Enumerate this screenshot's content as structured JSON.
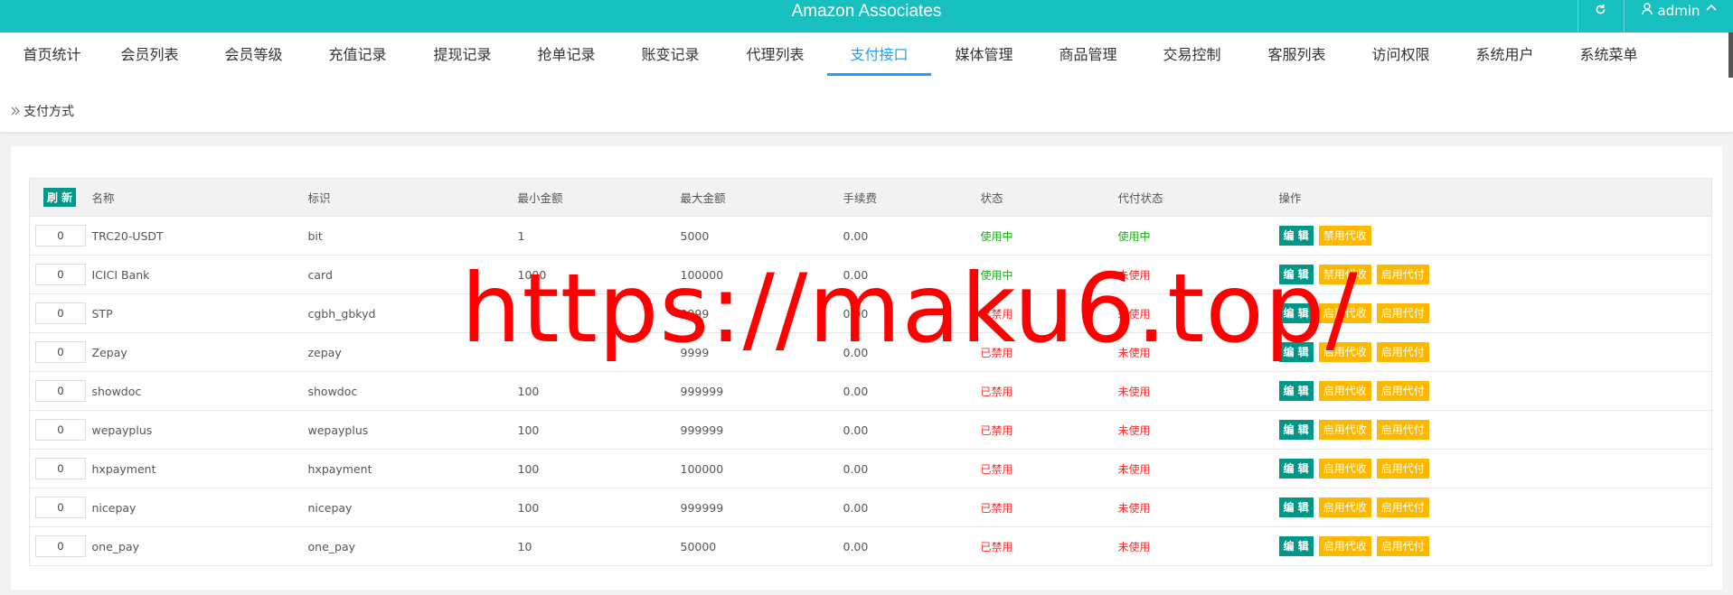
{
  "header": {
    "title": "Amazon Associates",
    "user": "admin",
    "refresh_icon": "refresh-icon",
    "user_icon": "user-icon",
    "accent": "#17bfbf"
  },
  "nav": {
    "tabs": [
      "首页统计",
      "会员列表",
      "会员等级",
      "充值记录",
      "提现记录",
      "抢单记录",
      "账变记录",
      "代理列表",
      "支付接口",
      "媒体管理",
      "商品管理",
      "交易控制",
      "客服列表",
      "访问权限",
      "系统用户",
      "系统菜单"
    ],
    "active": "支付接口"
  },
  "breadcrumb": {
    "label": "支付方式"
  },
  "table": {
    "refresh_label": "刷 新",
    "columns": [
      "名称",
      "标识",
      "最小金额",
      "最大金额",
      "手续费",
      "状态",
      "代付状态",
      "操作"
    ],
    "rows": [
      {
        "sort": "0",
        "name": "TRC20-USDT",
        "code": "bit",
        "min": "1",
        "max": "5000",
        "fee": "0.00",
        "status": "使用中",
        "payout": "使用中",
        "actions": [
          "编 辑",
          "禁用代收"
        ]
      },
      {
        "sort": "0",
        "name": "ICICI Bank",
        "code": "card",
        "min": "1000",
        "max": "100000",
        "fee": "0.00",
        "status": "使用中",
        "payout": "未使用",
        "actions": [
          "编 辑",
          "禁用代收",
          "启用代付"
        ]
      },
      {
        "sort": "0",
        "name": "STP",
        "code": "cgbh_gbkyd",
        "min": "",
        "max": "9999",
        "fee": "0.00",
        "status": "已禁用",
        "payout": "未使用",
        "actions": [
          "编 辑",
          "启用代收",
          "启用代付"
        ]
      },
      {
        "sort": "0",
        "name": "Zepay",
        "code": "zepay",
        "min": "",
        "max": "9999",
        "fee": "0.00",
        "status": "已禁用",
        "payout": "未使用",
        "actions": [
          "编 辑",
          "启用代收",
          "启用代付"
        ]
      },
      {
        "sort": "0",
        "name": "showdoc",
        "code": "showdoc",
        "min": "100",
        "max": "999999",
        "fee": "0.00",
        "status": "已禁用",
        "payout": "未使用",
        "actions": [
          "编 辑",
          "启用代收",
          "启用代付"
        ]
      },
      {
        "sort": "0",
        "name": "wepayplus",
        "code": "wepayplus",
        "min": "100",
        "max": "999999",
        "fee": "0.00",
        "status": "已禁用",
        "payout": "未使用",
        "actions": [
          "编 辑",
          "启用代收",
          "启用代付"
        ]
      },
      {
        "sort": "0",
        "name": "hxpayment",
        "code": "hxpayment",
        "min": "100",
        "max": "100000",
        "fee": "0.00",
        "status": "已禁用",
        "payout": "未使用",
        "actions": [
          "编 辑",
          "启用代收",
          "启用代付"
        ]
      },
      {
        "sort": "0",
        "name": "nicepay",
        "code": "nicepay",
        "min": "100",
        "max": "999999",
        "fee": "0.00",
        "status": "已禁用",
        "payout": "未使用",
        "actions": [
          "编 辑",
          "启用代收",
          "启用代付"
        ]
      },
      {
        "sort": "0",
        "name": "one_pay",
        "code": "one_pay",
        "min": "10",
        "max": "50000",
        "fee": "0.00",
        "status": "已禁用",
        "payout": "未使用",
        "actions": [
          "编 辑",
          "启用代收",
          "启用代付"
        ]
      }
    ]
  },
  "watermark": "https://maku6.top/"
}
